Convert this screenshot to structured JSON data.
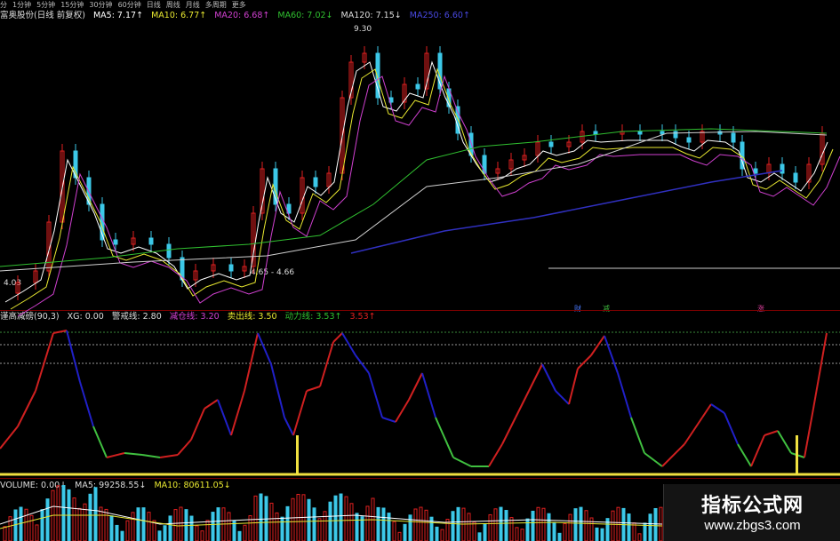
{
  "toolbar": {
    "items": [
      "分",
      "1分钟",
      "5分钟",
      "15分钟",
      "30分钟",
      "60分钟",
      "日线",
      "周线",
      "月线",
      "多周期",
      "更多"
    ]
  },
  "ma_legend": {
    "stock": "富奥股份(日线 前复权)",
    "ma5": "MA5: 7.17↑",
    "ma10": "MA10: 6.77↑",
    "ma20": "MA20: 6.68↑",
    "ma60": "MA60: 7.02↓",
    "ma120": "MA120: 7.15↓",
    "ma250": "MA250: 6.60↑"
  },
  "price_labels": {
    "high": "9.30",
    "low_range": "4.65 - 4.66",
    "left_low": "4.03"
  },
  "markers": {
    "cai": "财",
    "jian": "减",
    "zhang": "涨"
  },
  "indicator_legend": {
    "name": "谨高减磅(90,3)",
    "xg": "XG: 0.00",
    "warn": "警戒线: 2.80",
    "reduce": "减仓线: 3.20",
    "sell": "卖出线: 3.50",
    "power": "动力线: 3.53↑",
    "value": "3.53↑"
  },
  "volume_legend": {
    "volume": "VOLUME: 0.00↓",
    "ma5": "MA5: 99258.55↓",
    "ma10": "MA10: 80611.05↓"
  },
  "watermark": {
    "title": "指标公式网",
    "url": "www.zbgs3.com"
  },
  "colors": {
    "up": "#e02020",
    "down": "#3cc8e8",
    "ma5": "#ffffff",
    "ma10": "#e8e830",
    "ma20": "#d040d0",
    "ma60": "#30c030",
    "ma250": "#3030c0",
    "ind_up": "#d02020",
    "ind_down": "#2020c8",
    "ind_mid": "#40c040",
    "signal": "#f0e040"
  }
}
